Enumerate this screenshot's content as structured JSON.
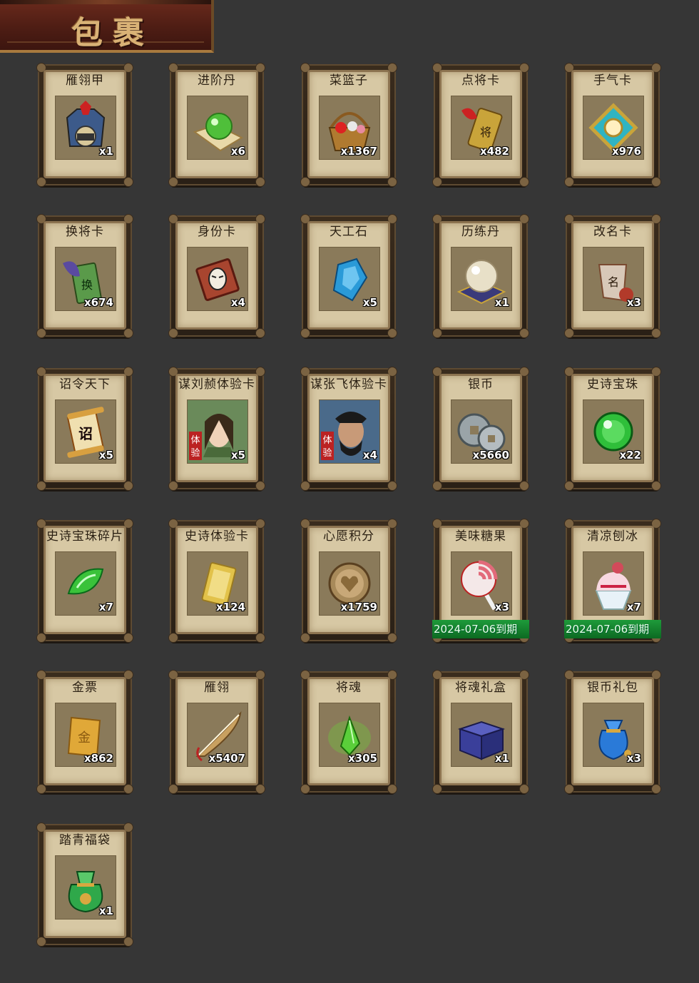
{
  "header": {
    "title": "包裹"
  },
  "items": [
    {
      "name": "雁翎甲",
      "count": "x1",
      "icon": "armor-icon",
      "color": "#3c5a8a"
    },
    {
      "name": "进阶丹",
      "count": "x6",
      "icon": "green-pill-icon",
      "color": "#4fbf3a"
    },
    {
      "name": "菜篮子",
      "count": "x1367",
      "icon": "basket-icon",
      "color": "#b07a30"
    },
    {
      "name": "点将卡",
      "count": "x482",
      "icon": "general-card-icon",
      "color": "#c9a43a"
    },
    {
      "name": "手气卡",
      "count": "x976",
      "icon": "luck-card-icon",
      "color": "#2fb4c2"
    },
    {
      "name": "换将卡",
      "count": "x674",
      "icon": "swap-card-icon",
      "color": "#5a9a4a"
    },
    {
      "name": "身份卡",
      "count": "x4",
      "icon": "identity-card-icon",
      "color": "#a8452f"
    },
    {
      "name": "天工石",
      "count": "x5",
      "icon": "crystal-icon",
      "color": "#2a9ad8"
    },
    {
      "name": "历练丹",
      "count": "x1",
      "icon": "pearl-icon",
      "color": "#e8e0c8"
    },
    {
      "name": "改名卡",
      "count": "x3",
      "icon": "rename-card-icon",
      "color": "#b23a2a"
    },
    {
      "name": "诏令天下",
      "count": "x5",
      "icon": "edict-scroll-icon",
      "color": "#d8a040"
    },
    {
      "name": "谋刘赪体验卡",
      "count": "x5",
      "icon": "hero-portrait-female-icon",
      "color": "#6a8a5a"
    },
    {
      "name": "谋张飞体验卡",
      "count": "x4",
      "icon": "hero-portrait-male-icon",
      "color": "#4a6a8a"
    },
    {
      "name": "银币",
      "count": "x5660",
      "icon": "silver-coin-icon",
      "color": "#9aa4a8"
    },
    {
      "name": "史诗宝珠",
      "count": "x22",
      "icon": "green-orb-icon",
      "color": "#2fbf3a"
    },
    {
      "name": "史诗宝珠碎片",
      "count": "x7",
      "icon": "green-shard-icon",
      "color": "#3ac23a"
    },
    {
      "name": "史诗体验卡",
      "count": "x124",
      "icon": "gold-card-icon",
      "color": "#e2c24a"
    },
    {
      "name": "心愿积分",
      "count": "x1759",
      "icon": "heart-coin-icon",
      "color": "#a88a5a"
    },
    {
      "name": "美味糖果",
      "count": "x3",
      "icon": "lollipop-icon",
      "color": "#e26a7a",
      "expiry": "2024-07-06到期"
    },
    {
      "name": "清凉刨冰",
      "count": "x7",
      "icon": "shaved-ice-icon",
      "color": "#d24a5a",
      "expiry": "2024-07-06到期"
    },
    {
      "name": "金票",
      "count": "x862",
      "icon": "gold-ticket-icon",
      "color": "#e0a838"
    },
    {
      "name": "雁翎",
      "count": "x5407",
      "icon": "feather-icon",
      "color": "#c8a060"
    },
    {
      "name": "将魂",
      "count": "x305",
      "icon": "soul-crystal-icon",
      "color": "#5acf3a"
    },
    {
      "name": "将魂礼盒",
      "count": "x1",
      "icon": "gift-box-icon",
      "color": "#3a3f9a"
    },
    {
      "name": "银币礼包",
      "count": "x3",
      "icon": "money-bag-icon",
      "color": "#2a7ad8"
    },
    {
      "name": "踏青福袋",
      "count": "x1",
      "icon": "lucky-bag-icon",
      "color": "#2fa84a"
    }
  ]
}
